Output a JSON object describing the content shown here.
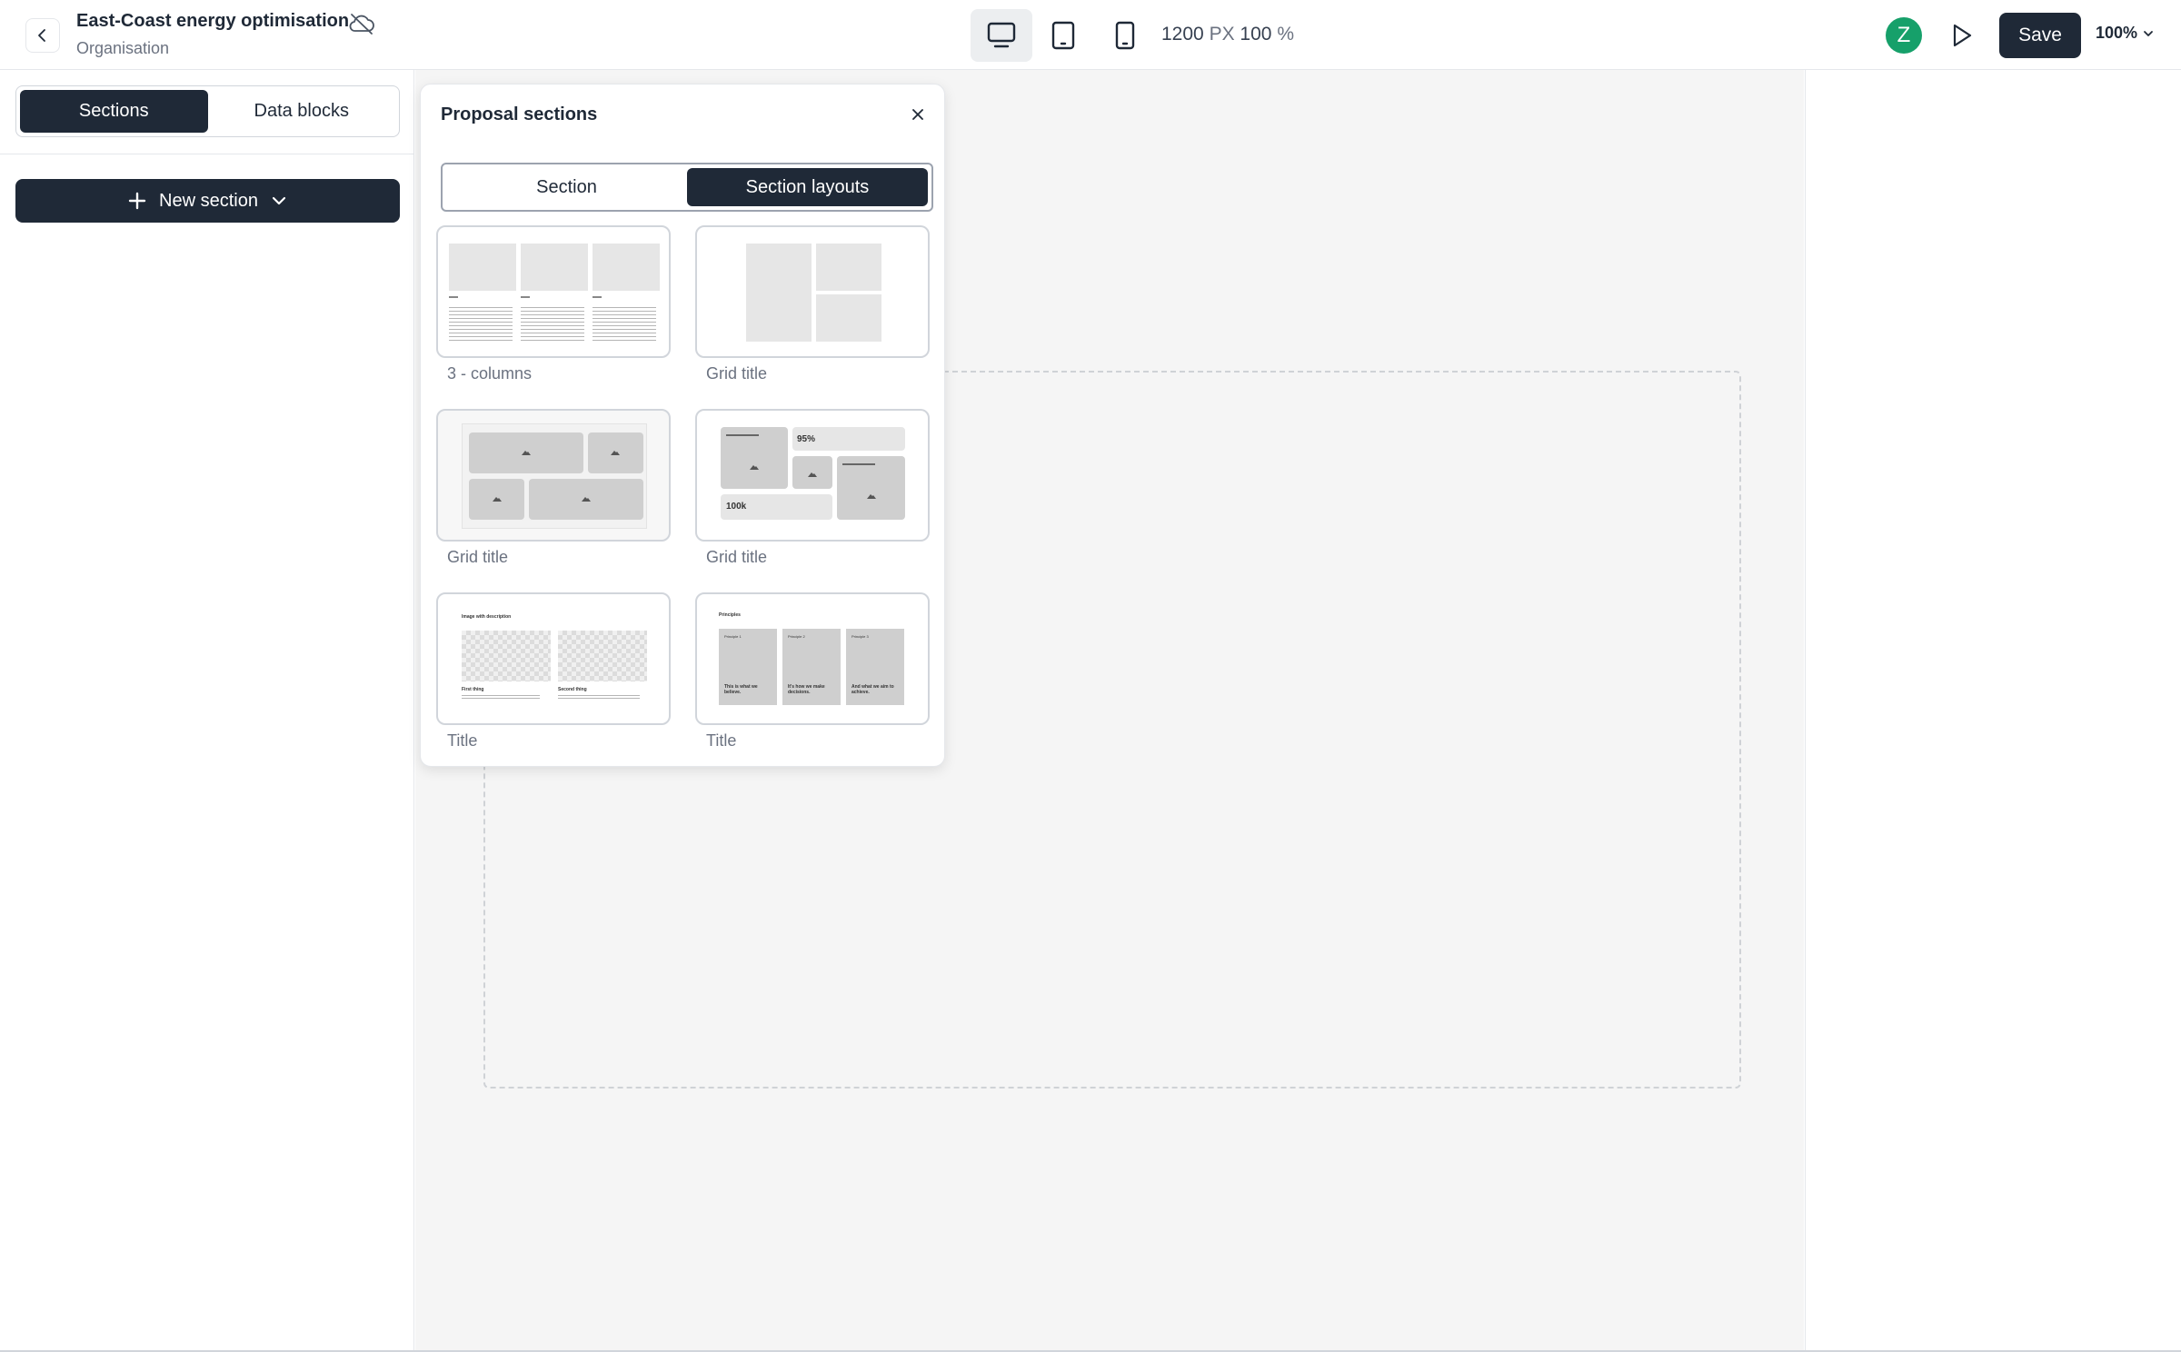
{
  "topbar": {
    "title": "East-Coast energy optimisation",
    "subtitle": "Organisation",
    "dimension_value": "1200",
    "dimension_unit": "PX",
    "scale_value": "100",
    "scale_unit": "%",
    "avatar_letter": "Z",
    "save_label": "Save",
    "zoom_label": "100%",
    "devices": [
      "desktop-icon",
      "tablet-icon",
      "mobile-icon"
    ]
  },
  "sidebar": {
    "tabs": [
      {
        "label": "Sections",
        "active": true
      },
      {
        "label": "Data blocks",
        "active": false
      }
    ],
    "new_section_label": "New section"
  },
  "popover": {
    "title": "Proposal sections",
    "tabs": [
      {
        "label": "Section",
        "active": false
      },
      {
        "label": "Section layouts",
        "active": true
      }
    ],
    "layouts": [
      {
        "label": "3 - columns",
        "preview": "three-columns"
      },
      {
        "label": "Grid title",
        "preview": "grid-two-right"
      },
      {
        "label": "Grid title",
        "preview": "image-grid"
      },
      {
        "label": "Grid title",
        "preview": "stats-grid",
        "stats": [
          "95%",
          "100k"
        ]
      },
      {
        "label": "Title",
        "preview": "image-with-description",
        "heading": "Image with description",
        "captions": [
          "First thing",
          "Second thing"
        ]
      },
      {
        "label": "Title",
        "preview": "principles",
        "heading": "Principles",
        "items": [
          "This is what we believe.",
          "It's how we make decisions.",
          "And what we aim to achieve."
        ],
        "item_titles": [
          "Principle 1",
          "Principle 2",
          "Principle 3"
        ]
      }
    ]
  },
  "colors": {
    "dark": "#1f2937",
    "avatar": "#16a06a",
    "canvas": "#f5f5f5"
  }
}
